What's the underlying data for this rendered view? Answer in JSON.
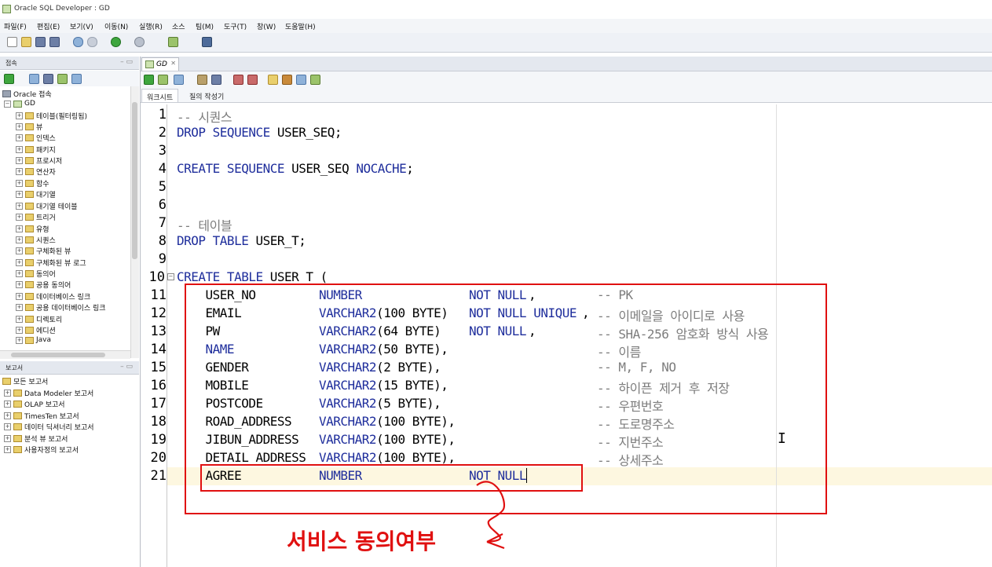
{
  "window": {
    "title": "Oracle SQL Developer : GD"
  },
  "menu": [
    "파일(F)",
    "편집(E)",
    "보기(V)",
    "이동(N)",
    "실행(R)",
    "소스",
    "팀(M)",
    "도구(T)",
    "창(W)",
    "도움말(H)"
  ],
  "connections_panel": {
    "title": "접속",
    "root_label": "Oracle 접속",
    "connection_name": "GD",
    "items": [
      "테이블(필터링됨)",
      "뷰",
      "인덱스",
      "패키지",
      "프로시저",
      "연산자",
      "함수",
      "대기열",
      "대기열 테이블",
      "트리거",
      "유형",
      "시퀀스",
      "구체화된 뷰",
      "구체화된 뷰 로그",
      "동의어",
      "공용 동의어",
      "데이터베이스 링크",
      "공용 데이터베이스 링크",
      "디렉토리",
      "에디션",
      "Java"
    ]
  },
  "reports_panel": {
    "title": "보고서",
    "root_label": "모든 보고서",
    "items": [
      "Data Modeler 보고서",
      "OLAP 보고서",
      "TimesTen 보고서",
      "데이터 딕셔너리 보고서",
      "분석 뷰 보고서",
      "사용자정의 보고서"
    ]
  },
  "editor": {
    "tab_label": "GD",
    "subtabs": [
      "워크시트",
      "질의 작성기"
    ],
    "line_numbers": [
      "1",
      "2",
      "3",
      "4",
      "5",
      "6",
      "7",
      "8",
      "9",
      "10",
      "11",
      "12",
      "13",
      "14",
      "15",
      "16",
      "17",
      "18",
      "19",
      "20",
      "21"
    ],
    "text": {
      "l1": "-- 시퀀스",
      "l2_kw": "DROP SEQUENCE",
      "l2_rest": " USER_SEQ;",
      "l4_kw": "CREATE SEQUENCE",
      "l4_mid": " USER_SEQ ",
      "l4_kw2": "NOCACHE",
      "l4_end": ";",
      "l7": "-- 테이블",
      "l8_kw": "DROP TABLE",
      "l8_rest": " USER_T;",
      "l10_kw": "CREATE TABLE",
      "l10_rest": " USER_T (",
      "l11_name": "    USER_NO",
      "l11_type": "NUMBER",
      "l11_cons": "NOT NULL",
      "l11_sep": ",",
      "l11_cm": "-- PK",
      "l12_name": "    EMAIL",
      "l12_type": "VARCHAR2",
      "l12_args": "(100 BYTE)",
      "l12_cons": "NOT NULL UNIQUE",
      "l12_sep": ",",
      "l12_cm": "-- 이메일을 아이디로 사용",
      "l13_name": "    PW",
      "l13_type": "VARCHAR2",
      "l13_args": "(64 BYTE)",
      "l13_cons": "NOT NULL",
      "l13_sep": ",",
      "l13_cm": "-- SHA-256 암호화 방식 사용",
      "l14_name": "    NAME",
      "l14_type": "VARCHAR2",
      "l14_args": "(50 BYTE),",
      "l14_cm": "-- 이름",
      "l15_name": "    GENDER",
      "l15_type": "VARCHAR2",
      "l15_args": "(2 BYTE),",
      "l15_cm": "-- M, F, NO",
      "l16_name": "    MOBILE",
      "l16_type": "VARCHAR2",
      "l16_args": "(15 BYTE),",
      "l16_cm": "-- 하이픈 제거 후 저장",
      "l17_name": "    POSTCODE",
      "l17_type": "VARCHAR2",
      "l17_args": "(5 BYTE),",
      "l17_cm": "-- 우편번호",
      "l18_name": "    ROAD_ADDRESS",
      "l18_type": "VARCHAR2",
      "l18_args": "(100 BYTE),",
      "l18_cm": "-- 도로명주소",
      "l19_name": "    JIBUN_ADDRESS",
      "l19_type": "VARCHAR2",
      "l19_args": "(100 BYTE),",
      "l19_cm": "-- 지번주소",
      "l20_name": "    DETAIL_ADDRESS",
      "l20_type": "VARCHAR2",
      "l20_args": "(100 BYTE),",
      "l20_cm": "-- 상세주소",
      "l21_name": "    AGREE",
      "l21_type": "NUMBER",
      "l21_cons": "NOT NULL"
    }
  },
  "annotation": {
    "label": "서비스 동의여부",
    "color": "#e01010"
  },
  "colors": {
    "keyword": "#1f2e9c",
    "comment": "#7d7d7d",
    "current_line": "#fdf7e0"
  }
}
